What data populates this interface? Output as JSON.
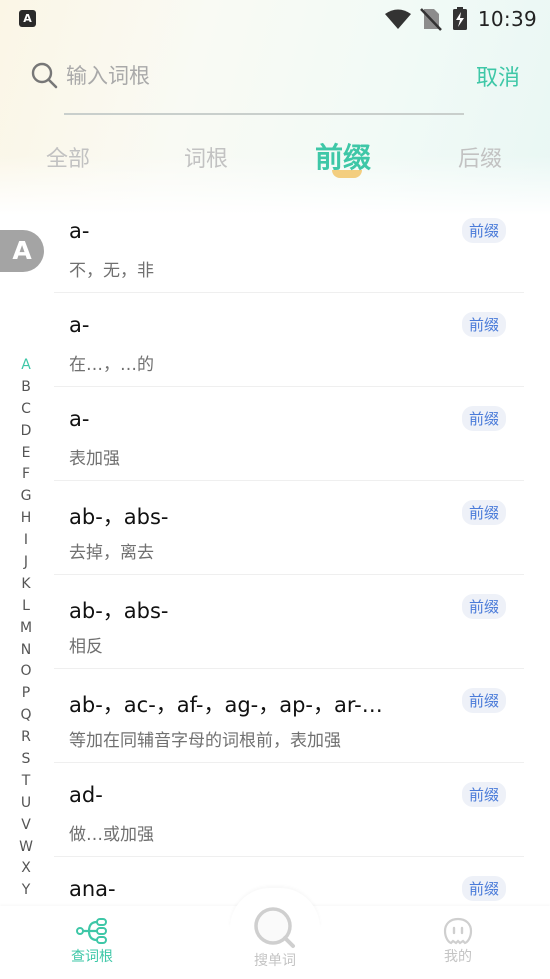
{
  "status_bar": {
    "time": "10:39",
    "app_glyph": "A"
  },
  "search": {
    "placeholder": "输入词根",
    "value": "",
    "cancel_label": "取消"
  },
  "tabs": [
    {
      "label": "全部",
      "active": false
    },
    {
      "label": "词根",
      "active": false
    },
    {
      "label": "前缀",
      "active": true
    },
    {
      "label": "后缀",
      "active": false
    }
  ],
  "current_letter": "A",
  "list": [
    {
      "word": "a-",
      "meaning": "不，无，非",
      "badge": "前缀"
    },
    {
      "word": "a-",
      "meaning": "在…，…的",
      "badge": "前缀"
    },
    {
      "word": "a-",
      "meaning": "表加强",
      "badge": "前缀"
    },
    {
      "word": "ab-，abs-",
      "meaning": "去掉，离去",
      "badge": "前缀"
    },
    {
      "word": "ab-，abs-",
      "meaning": "相反",
      "badge": "前缀"
    },
    {
      "word": "ab-，ac-，af-，ag-，ap-，ar-…",
      "meaning": "等加在同辅音字母的词根前，表加强",
      "badge": "前缀"
    },
    {
      "word": "ad-",
      "meaning": "做…或加强",
      "badge": "前缀"
    },
    {
      "word": "ana-",
      "meaning": "",
      "badge": "前缀"
    }
  ],
  "index_letters": [
    "A",
    "B",
    "C",
    "D",
    "E",
    "F",
    "G",
    "H",
    "I",
    "J",
    "K",
    "L",
    "M",
    "N",
    "O",
    "P",
    "Q",
    "R",
    "S",
    "T",
    "U",
    "V",
    "W",
    "X",
    "Y"
  ],
  "bottom_nav": [
    {
      "label": "查词根",
      "icon": "root-tree-icon",
      "active": true
    },
    {
      "label": "搜单词",
      "icon": "search-icon",
      "active": false
    },
    {
      "label": "我的",
      "icon": "profile-face-icon",
      "active": false
    }
  ],
  "colors": {
    "accent": "#3ec7a7",
    "badge_text": "#4a7bd9",
    "badge_bg": "#eef1f8",
    "tab_marker": "#f2c66a"
  }
}
